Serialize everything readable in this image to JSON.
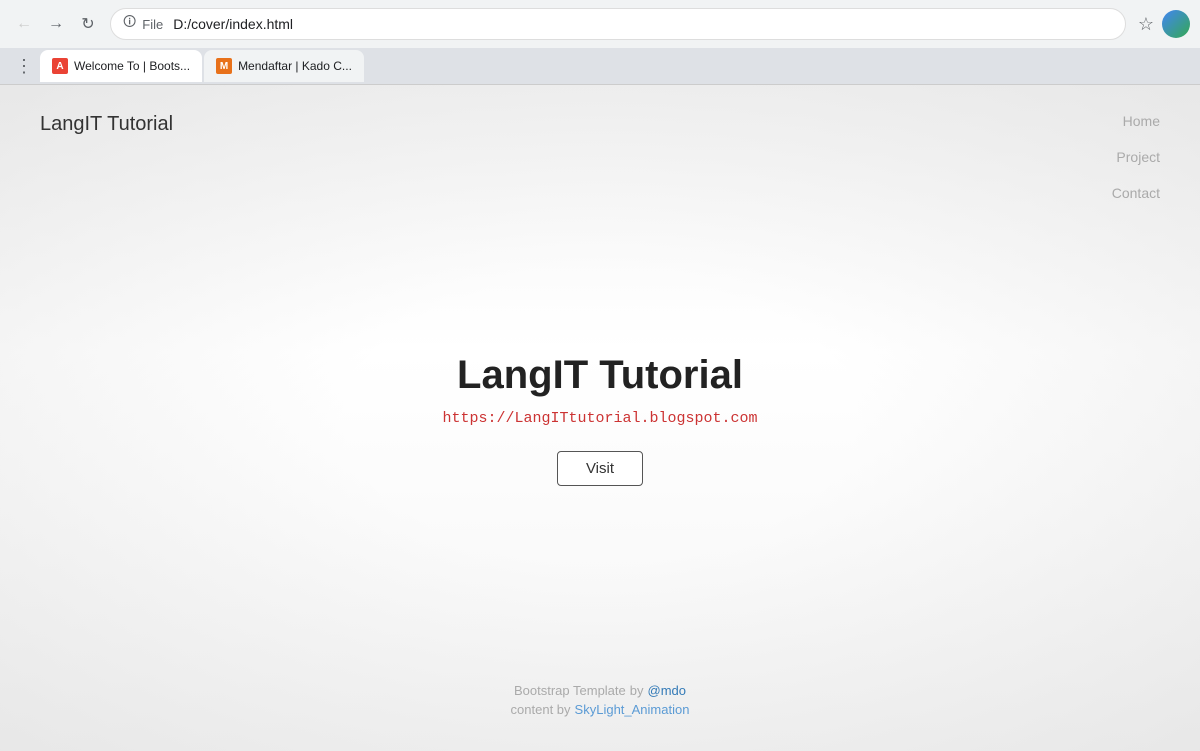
{
  "browser": {
    "url": "D:/cover/index.html",
    "file_label": "File",
    "tabs": [
      {
        "id": "tab1",
        "label": "Welcome To | Boots...",
        "favicon_text": "A",
        "favicon_class": "red",
        "active": true
      },
      {
        "id": "tab2",
        "label": "Mendaftar | Kado C...",
        "favicon_text": "M",
        "favicon_class": "orange",
        "active": false
      }
    ]
  },
  "navbar": {
    "brand": "LangIT Tutorial",
    "nav_links": [
      {
        "label": "Home"
      },
      {
        "label": "Project"
      },
      {
        "label": "Contact"
      }
    ]
  },
  "main": {
    "title": "LangIT Tutorial",
    "url_text": "https://LangITtutorial.blogspot.com",
    "visit_label": "Visit"
  },
  "footer": {
    "line1_text": "Bootstrap Template",
    "line1_by": "by",
    "line1_author": "@mdo",
    "line2_text": "content by",
    "line2_author": "SkyLight_Animation"
  }
}
